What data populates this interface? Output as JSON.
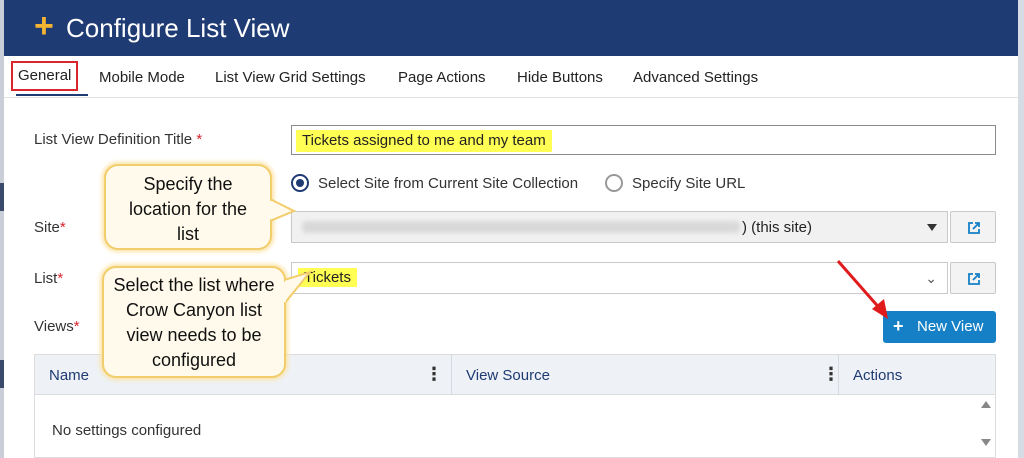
{
  "header": {
    "title": "Configure List View"
  },
  "tabs": [
    {
      "label": "General"
    },
    {
      "label": "Mobile Mode"
    },
    {
      "label": "List View Grid Settings"
    },
    {
      "label": "Page Actions"
    },
    {
      "label": "Hide Buttons"
    },
    {
      "label": "Advanced Settings"
    }
  ],
  "form": {
    "title_label": "List View Definition Title",
    "required_mark": "*",
    "title_value": "Tickets assigned to me and my team",
    "site_options": [
      {
        "label": "Select Site from Current Site Collection",
        "selected": true
      },
      {
        "label": "Specify Site URL",
        "selected": false
      }
    ],
    "site_label": "Site",
    "site_value_suffix": ") (this site)",
    "list_label": "List",
    "list_value": "Tickets",
    "views_label": "Views"
  },
  "views": {
    "new_button": "New View",
    "columns": [
      "Name",
      "View Source",
      "Actions"
    ],
    "empty_text": "No settings configured"
  },
  "callouts": {
    "site": "Specify the location for the list",
    "list": "Select the list where Crow Canyon list view needs to be configured"
  },
  "colors": {
    "header_bg": "#1f3b73",
    "accent_plus": "#f5b531",
    "primary_button": "#1580c6",
    "highlight": "#ffff54",
    "annotation_red": "#d9262c"
  },
  "icons": {
    "header_plus": "plus-icon",
    "external_link": "external-link-icon",
    "column_menu": "vertical-dots-icon"
  }
}
